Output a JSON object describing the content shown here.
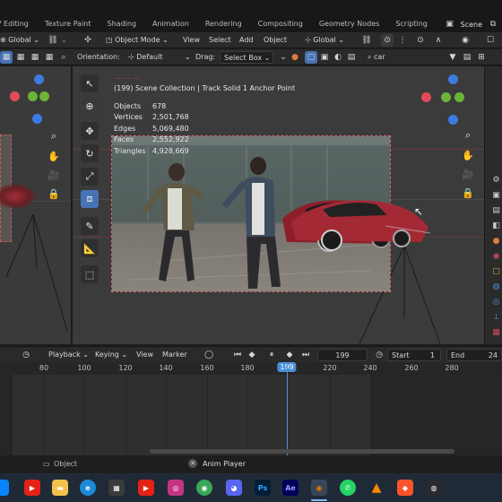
{
  "workspaces": {
    "tabs": [
      "V Editing",
      "Texture Paint",
      "Shading",
      "Animation",
      "Rendering",
      "Compositing",
      "Geometry Nodes",
      "Scripting"
    ],
    "add": "+",
    "scene_label": "Scene"
  },
  "header": {
    "left_orientation": "Global",
    "mode": "Object Mode",
    "menu": [
      "View",
      "Select",
      "Add",
      "Object"
    ],
    "transform_orientation": "Global"
  },
  "tool_settings": {
    "orientation_label": "Orientation:",
    "orientation_value": "Default",
    "drag_label": "Drag:",
    "drag_value": "Select Box",
    "search_value": "car"
  },
  "viewport": {
    "view_label": "... ... ...",
    "collection_line": "(199) Scene Collection | Track Solid 1 Anchor Point",
    "stats": [
      {
        "label": "Objects",
        "value": "678"
      },
      {
        "label": "Vertices",
        "value": "2,501,768"
      },
      {
        "label": "Edges",
        "value": "5,069,480"
      },
      {
        "label": "Faces",
        "value": "2,552,922"
      },
      {
        "label": "Triangles",
        "value": "4,928,669"
      }
    ],
    "gizmo": {
      "x": "X",
      "y": "Y",
      "z": "Z"
    }
  },
  "timeline": {
    "menu": [
      "Playback",
      "Keying",
      "View",
      "Marker"
    ],
    "current_frame": "199",
    "start_label": "Start",
    "start_value": "1",
    "end_label": "End",
    "end_value": "24",
    "ruler_ticks": [
      "80",
      "100",
      "120",
      "140",
      "160",
      "180",
      "199",
      "220",
      "240",
      "260",
      "280"
    ],
    "playhead_label": "199"
  },
  "status_bar": {
    "left": "Object",
    "center": "Anim Player"
  },
  "taskbar": {
    "apps": [
      "youtube",
      "file-explorer",
      "edge",
      "store",
      "youtube",
      "instagram",
      "chrome",
      "discord",
      "photoshop",
      "after-effects",
      "blender",
      "whatsapp",
      "vlc",
      "brave",
      "other"
    ],
    "labels": {
      "ps": "Ps",
      "ae": "Ae"
    }
  },
  "colors": {
    "accent": "#4772b3",
    "playhead": "#4a90d9",
    "x_axis": "#e04a5a",
    "y_axis": "#6cb33a",
    "z_axis": "#3c7be0"
  }
}
